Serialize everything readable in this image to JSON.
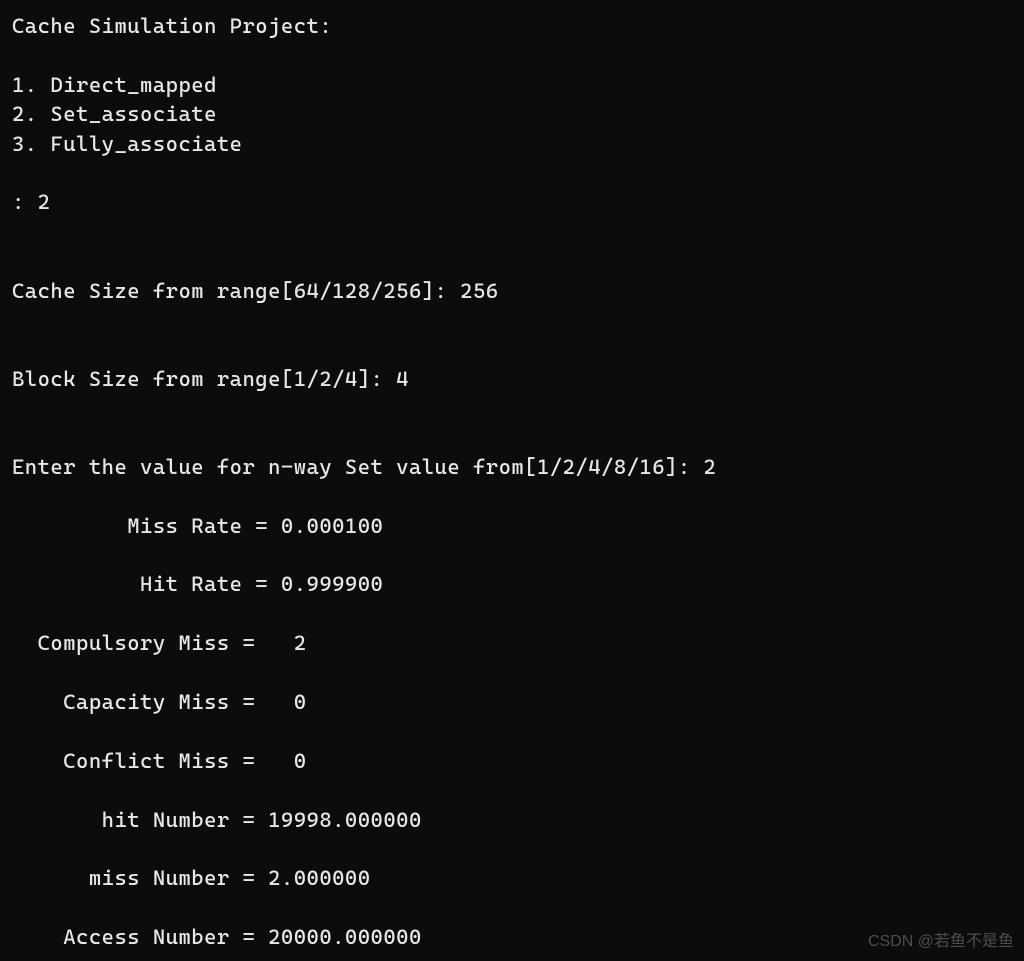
{
  "header": {
    "title": "Cache Simulation Project:"
  },
  "menu": {
    "item1": "1. Direct_mapped",
    "item2": "2. Set_associate",
    "item3": "3. Fully_associate"
  },
  "prompts": {
    "selection_prompt": ": ",
    "selection_value": "2",
    "cache_size_prompt": "Cache Size from range[64/128/256]: ",
    "cache_size_value": "256",
    "block_size_prompt": "Block Size from range[1/2/4]: ",
    "block_size_value": "4",
    "nway_prompt": "Enter the value for n-way Set value from[1/2/4/8/16]: ",
    "nway_value": "2"
  },
  "results": {
    "miss_rate_label": "         Miss Rate = ",
    "miss_rate_value": "0.000100",
    "hit_rate_label": "          Hit Rate = ",
    "hit_rate_value": "0.999900",
    "compulsory_miss_label": "  Compulsory Miss =   ",
    "compulsory_miss_value": "2",
    "capacity_miss_label": "    Capacity Miss =   ",
    "capacity_miss_value": "0",
    "conflict_miss_label": "    Conflict Miss =   ",
    "conflict_miss_value": "0",
    "hit_number_label": "       hit Number = ",
    "hit_number_value": "19998.000000",
    "miss_number_label": "      miss Number = ",
    "miss_number_value": "2.000000",
    "access_number_label": "    Access Number = ",
    "access_number_value": "20000.000000"
  },
  "watermark": {
    "text": "CSDN @若鱼不是鱼"
  }
}
